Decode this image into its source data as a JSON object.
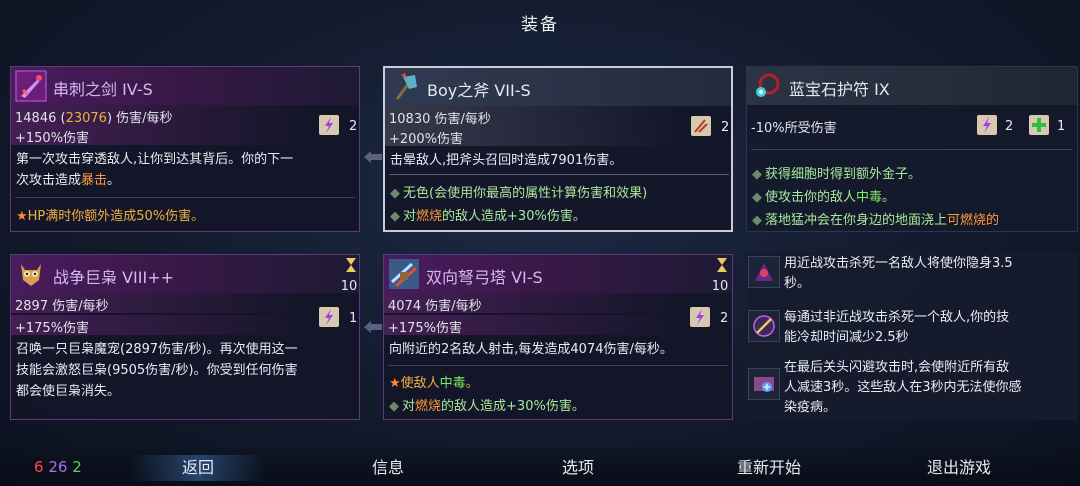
{
  "title": "装备",
  "stats": {
    "red": "6",
    "purple": "26",
    "green": "2"
  },
  "menu": [
    "返回",
    "信息",
    "选项",
    "重新开始",
    "退出游戏"
  ],
  "cards": {
    "weapon1": {
      "name": "串刺之剑 IV-S",
      "dps_main": "14846",
      "dps_paren": "23076",
      "dps_unit": "伤害/每秒",
      "bonus": "+150%伤害",
      "scroll_count": "2",
      "desc_line1": "第一次攻击穿透敌人,让你到达其背后。你的下一",
      "desc_line2_prefix": "次攻击造成",
      "desc_line2_hl": "暴击",
      "desc_line2_suffix": "。",
      "perk": "HP满时你额外造成50%伤害。"
    },
    "weapon2": {
      "name": "Boy之斧 VII-S",
      "dps": "10830 伤害/每秒",
      "bonus": "+200%伤害",
      "scroll_count": "2",
      "desc": "击晕敌人,把斧头召回时造成7901伤害。",
      "bullet1": "无色(会使用你最高的属性计算伤害和效果)",
      "bullet2_prefix": "对",
      "bullet2_hl": "燃烧",
      "bullet2_suffix": "的敌人造成+30%伤害。"
    },
    "amulet": {
      "name": "蓝宝石护符 IX",
      "stat": "-10%所受伤害",
      "scroll_purple": "2",
      "scroll_green": "1",
      "bullet1": "获得细胞时得到额外金子。",
      "bullet2_prefix": "使攻击你的敌人",
      "bullet2_hl": "中毒",
      "bullet2_suffix": "。",
      "bullet3_prefix": "落地猛冲会在你身边的地面浇上",
      "bullet3_hl": "可燃烧的"
    },
    "skill1": {
      "name": "战争巨枭 VIII++",
      "dps": "2897 伤害/每秒",
      "bonus": "+175%伤害",
      "cooldown": "10",
      "scroll_count": "1",
      "desc_line1": "召唤一只巨枭魔宠(2897伤害/秒)。再次使用这一",
      "desc_line2": "技能会激怒巨枭(9505伤害/秒)。你受到任何伤害",
      "desc_line3": "都会使巨枭消失。"
    },
    "skill2": {
      "name": "双向弩弓塔 VI-S",
      "dps": "4074 伤害/每秒",
      "bonus": "+175%伤害",
      "cooldown": "10",
      "scroll_count": "2",
      "desc": "向附近的2名敌人射击,每发造成4074伤害/每秒。",
      "bullet1_prefix": "使敌人",
      "bullet1_hl": "中毒",
      "bullet1_suffix": "。",
      "bullet2_prefix": "对",
      "bullet2_hl": "燃烧",
      "bullet2_suffix": "的敌人造成+30%伤害。"
    }
  },
  "mutations": [
    {
      "line1": "用近战攻击杀死一名敌人将使你隐身3.5",
      "line2": "秒。"
    },
    {
      "line1": "每通过非近战攻击杀死一个敌人,你的技",
      "line2": "能冷却时间减少2.5秒"
    },
    {
      "line1": "在最后关头闪避攻击时,会使附近所有敌",
      "line2": "人减速3秒。这些敌人在3秒内无法使你感",
      "line3": "染疫病。"
    }
  ]
}
